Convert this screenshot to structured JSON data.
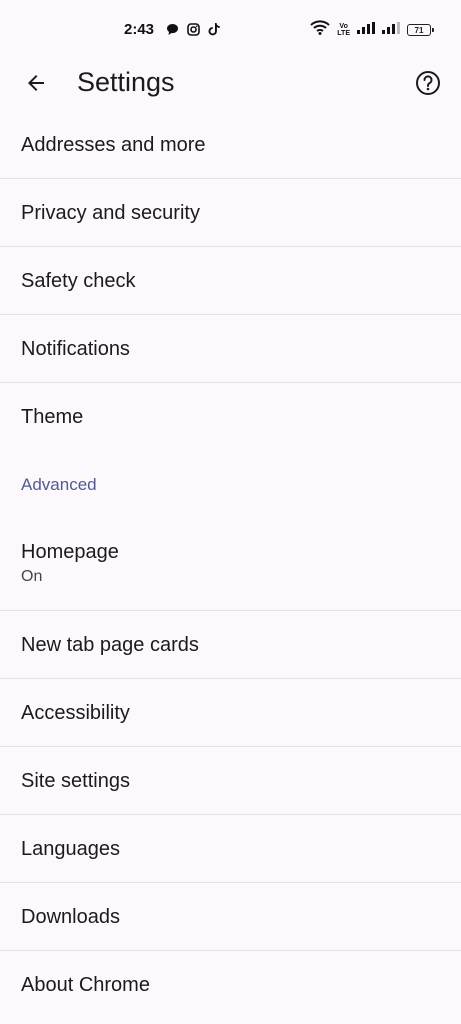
{
  "status_bar": {
    "time": "2:43",
    "left_icons": [
      "chat-bubble-icon",
      "instagram-icon",
      "tiktok-icon"
    ],
    "volte_label_top": "Vo",
    "volte_label_bottom": "LTE",
    "battery_level": "71"
  },
  "app_bar": {
    "title": "Settings",
    "back_icon": "arrow-back-icon",
    "help_icon": "help-icon"
  },
  "settings": {
    "items_top": [
      {
        "label": "Addresses and more"
      },
      {
        "label": "Privacy and security"
      },
      {
        "label": "Safety check"
      },
      {
        "label": "Notifications"
      },
      {
        "label": "Theme"
      }
    ],
    "advanced_header": "Advanced",
    "homepage": {
      "label": "Homepage",
      "sub": "On"
    },
    "items_bottom": [
      {
        "label": "New tab page cards"
      },
      {
        "label": "Accessibility"
      },
      {
        "label": "Site settings"
      },
      {
        "label": "Languages"
      },
      {
        "label": "Downloads"
      },
      {
        "label": "About Chrome"
      }
    ]
  },
  "colors": {
    "background": "#fcf8fc",
    "accent_header": "#505a92",
    "divider": "#e3e1e6"
  }
}
